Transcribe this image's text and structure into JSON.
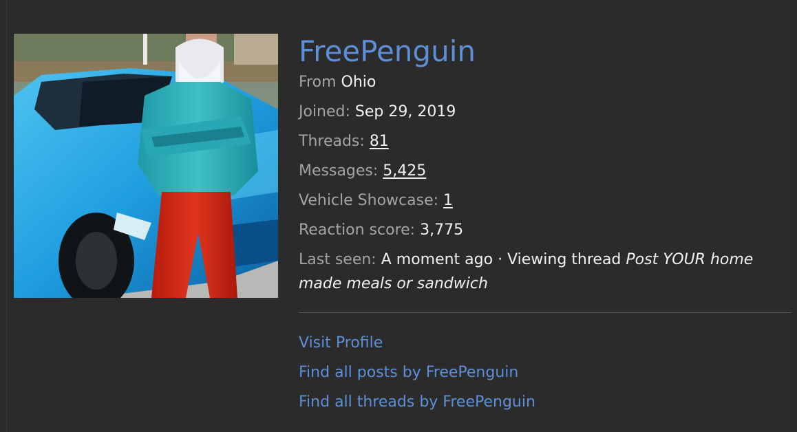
{
  "profile": {
    "username": "FreePenguin",
    "from_label": "From",
    "from_value": "Ohio",
    "joined_label": "Joined:",
    "joined_value": "Sep 29, 2019",
    "threads_label": "Threads:",
    "threads_value": "81",
    "messages_label": "Messages:",
    "messages_value": "5,425",
    "vehicle_label": "Vehicle Showcase:",
    "vehicle_value": "1",
    "reaction_label": "Reaction score:",
    "reaction_value": "3,775",
    "last_seen_label": "Last seen:",
    "last_seen_value": "A moment ago · Viewing thread",
    "last_seen_thread": "Post YOUR home made meals or sandwich"
  },
  "links": {
    "visit_profile": "Visit Profile",
    "find_posts": "Find all posts by FreePenguin",
    "find_threads": "Find all threads by FreePenguin"
  },
  "colors": {
    "background": "#2b2b2c",
    "link": "#5c8fd6",
    "label": "#a4a4a4",
    "value": "#f1f1f1"
  }
}
